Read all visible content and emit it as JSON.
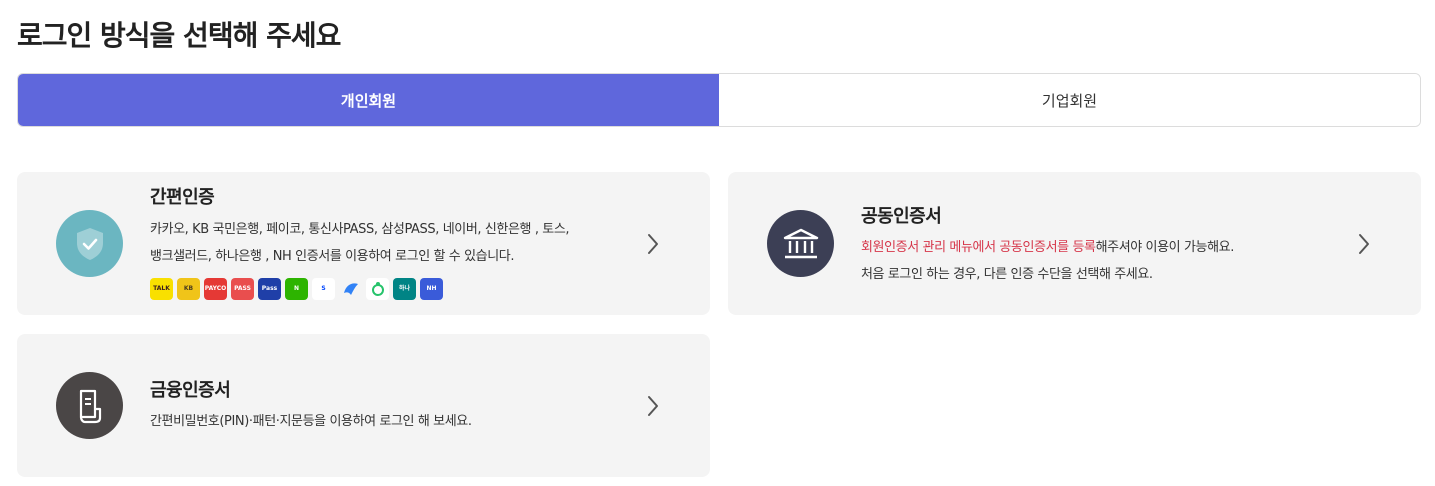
{
  "page_title": "로그인 방식을 선택해 주세요",
  "tabs": [
    {
      "label": "개인회원",
      "active": true
    },
    {
      "label": "기업회원",
      "active": false
    }
  ],
  "cards": {
    "simple": {
      "title": "간편인증",
      "desc_line1": "카카오, KB 국민은행, 페이코, 통신사PASS, 삼성PASS, 네이버, 신한은행 , 토스,",
      "desc_line2": "뱅크샐러드, 하나은행 , NH 인증서를 이용하여 로그인 할 수 있습니다.",
      "icon": "shield-check-icon",
      "logos": [
        {
          "name": "kakao-logo",
          "text": "TALK",
          "bg": "#f9e000",
          "fg": "#3a1d1d"
        },
        {
          "name": "kb-logo",
          "text": "KB",
          "bg": "#f0c419",
          "fg": "#4a3b1f"
        },
        {
          "name": "payco-logo",
          "text": "PAYCO",
          "bg": "#e53935",
          "fg": "#ffffff"
        },
        {
          "name": "pass-logo",
          "text": "PASS",
          "bg": "#e94e4e",
          "fg": "#ffffff"
        },
        {
          "name": "samsung-pass-logo",
          "text": "Pass",
          "bg": "#1f3fa8",
          "fg": "#ffffff"
        },
        {
          "name": "naver-logo",
          "text": "N",
          "bg": "#2db400",
          "fg": "#ffffff"
        },
        {
          "name": "shinhan-logo",
          "text": "S",
          "bg": "#ffffff",
          "fg": "#0046ff"
        },
        {
          "name": "toss-logo",
          "text": "",
          "bg": "#f4f4f4",
          "fg": "#3182f6"
        },
        {
          "name": "banksalad-logo",
          "text": "",
          "bg": "#ffffff",
          "fg": "#26c36b"
        },
        {
          "name": "hana-logo",
          "text": "하나",
          "bg": "#008485",
          "fg": "#ffffff"
        },
        {
          "name": "nh-logo",
          "text": "NH",
          "bg": "#3a5bd9",
          "fg": "#ffffff"
        }
      ]
    },
    "joint": {
      "title": "공동인증서",
      "desc_red": "회원인증서 관리 메뉴에서 공동인증서를 등록",
      "desc_rest": "해주셔야 이용이 가능해요.",
      "desc_line2": "처음 로그인 하는 경우, 다른 인증 수단을 선택해 주세요.",
      "icon": "bank-icon"
    },
    "finance": {
      "title": "금융인증서",
      "desc_line1": "간편비밀번호(PIN)·패턴·지문등을 이용하여 로그인 해 보세요.",
      "icon": "document-icon"
    }
  },
  "colors": {
    "accent": "#5f67dc",
    "shield_bg": "#6bb6c1",
    "bank_bg": "#3c3f55",
    "doc_bg": "#4a4646",
    "highlight_red": "#d6364a"
  }
}
